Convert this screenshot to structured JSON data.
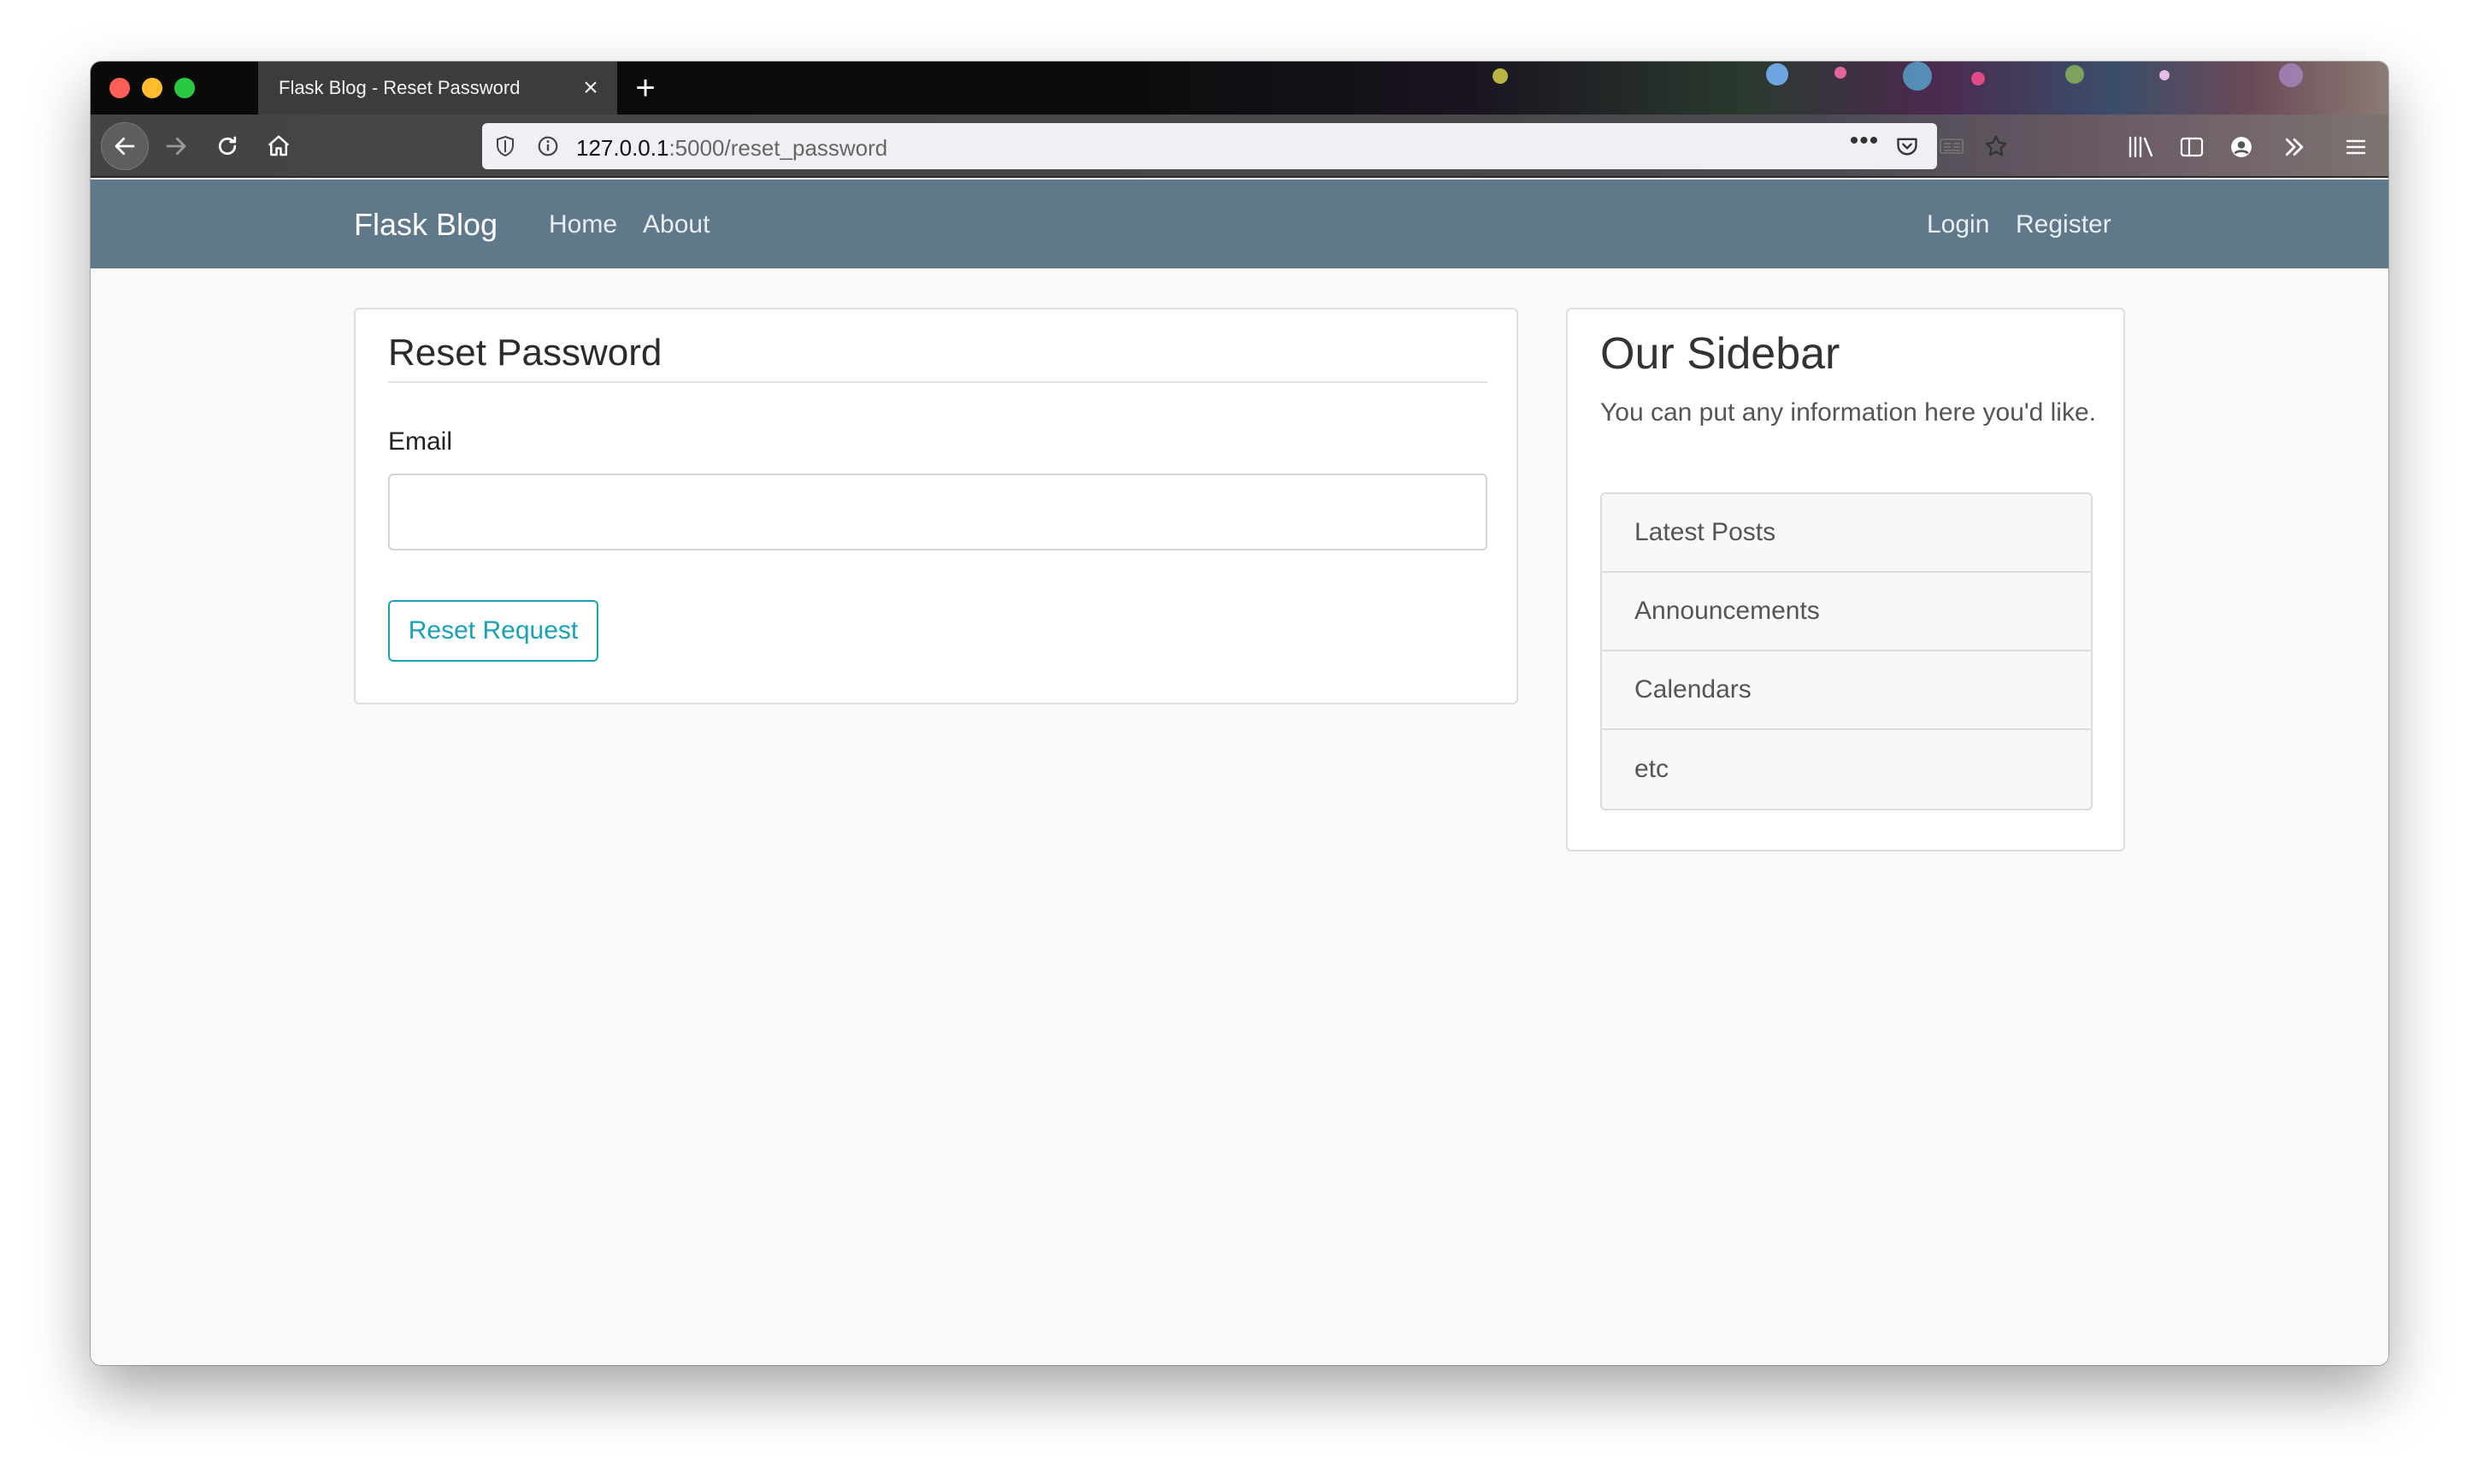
{
  "browser": {
    "tab_title": "Flask Blog - Reset Password",
    "tab_close_glyph": "×",
    "new_tab_glyph": "+",
    "url_host": "127.0.0.1",
    "url_rest": ":5000/reset_password",
    "url_dots_glyph": "•••"
  },
  "navbar": {
    "brand": "Flask Blog",
    "left_links": [
      "Home",
      "About"
    ],
    "right_links": [
      "Login",
      "Register"
    ],
    "background_color": "#5f788a"
  },
  "reset_form": {
    "title": "Reset Password",
    "email_label": "Email",
    "email_value": "",
    "submit_label": "Reset Request",
    "accent_color": "#17a2b8"
  },
  "sidebar": {
    "title": "Our Sidebar",
    "description": "You can put any information here you'd like.",
    "items": [
      "Latest Posts",
      "Announcements",
      "Calendars",
      "etc"
    ]
  }
}
